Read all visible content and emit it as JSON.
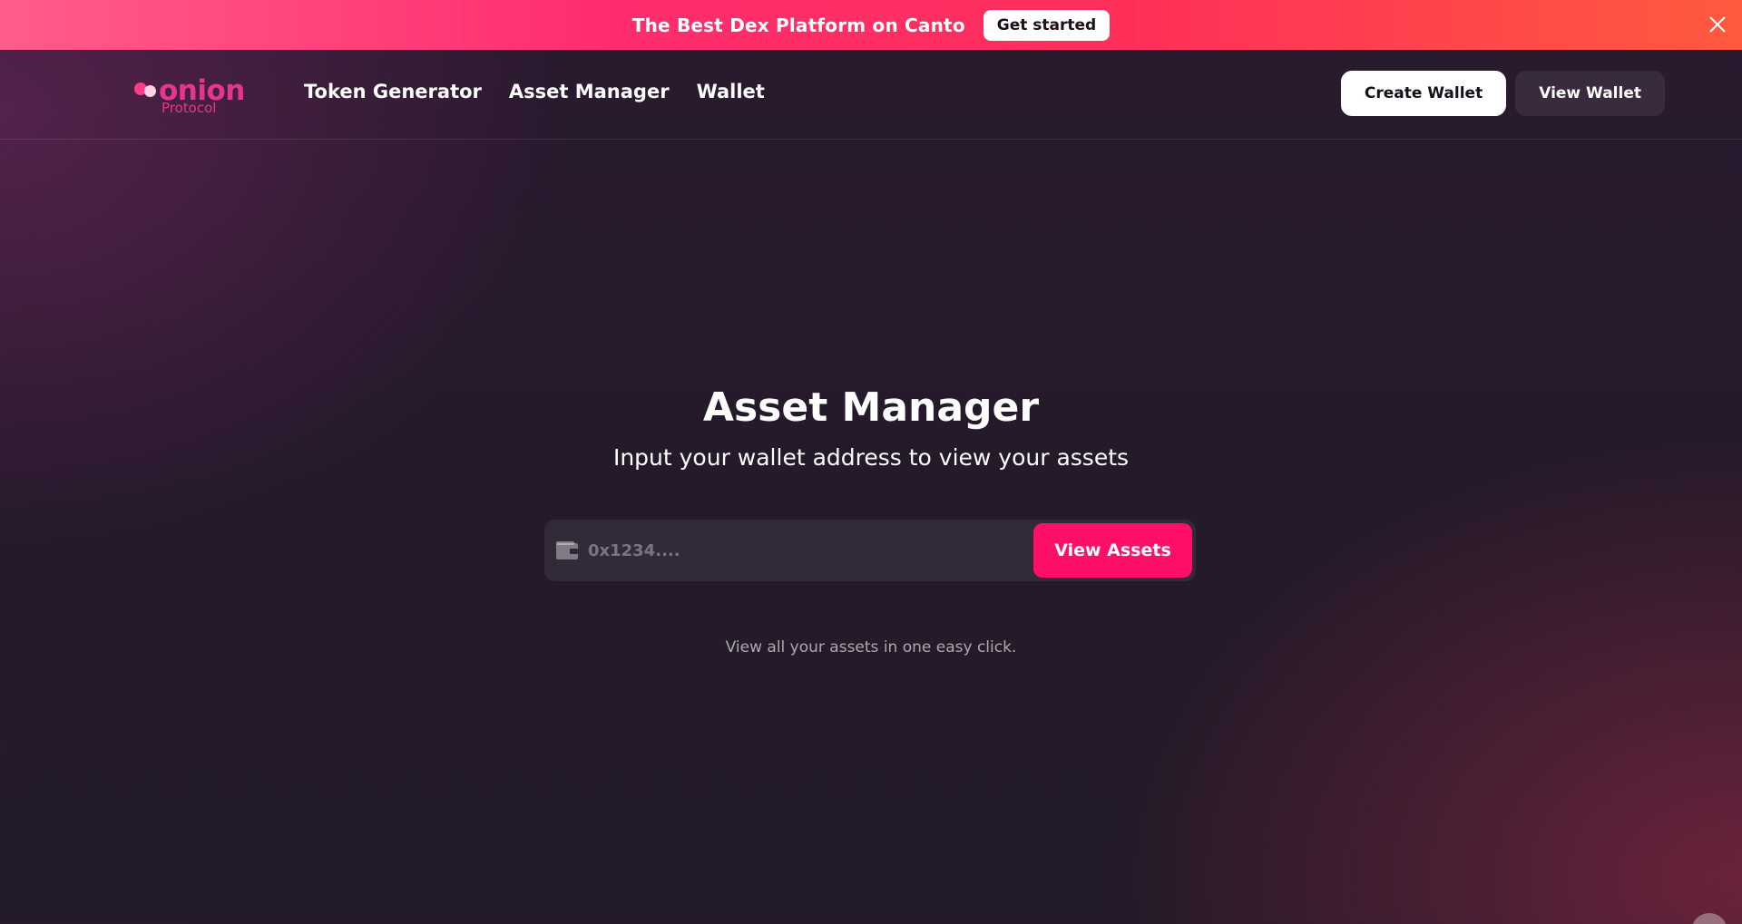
{
  "banner": {
    "text": "The Best Dex Platform on Canto",
    "cta_label": "Get started"
  },
  "header": {
    "logo": {
      "word": "onion",
      "sub": "Protocol"
    },
    "nav": [
      {
        "label": "Token Generator"
      },
      {
        "label": "Asset Manager"
      },
      {
        "label": "Wallet"
      }
    ],
    "actions": {
      "create_wallet_label": "Create Wallet",
      "view_wallet_label": "View Wallet"
    }
  },
  "main": {
    "title": "Asset Manager",
    "subtitle": "Input your wallet address to view your assets",
    "search": {
      "placeholder": "0x1234....",
      "value": "",
      "button_label": "View Assets",
      "icon": "wallet-icon"
    },
    "helper_text": "View all your assets in one easy click."
  },
  "colors": {
    "accent": "#ff0f67",
    "banner_start": "#ff5c8a",
    "banner_end": "#ff5a3d",
    "logo": "#e6358d",
    "background": "#241a2a"
  }
}
